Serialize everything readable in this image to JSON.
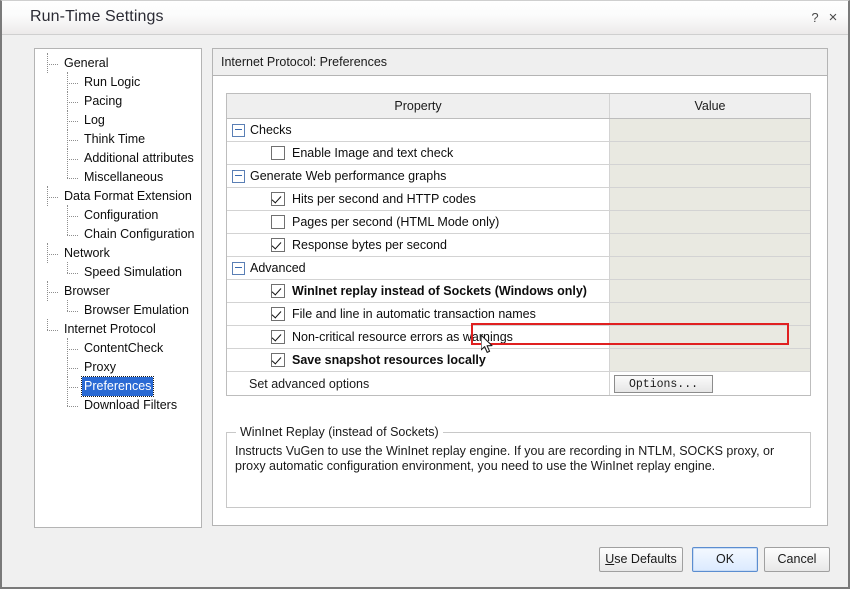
{
  "window": {
    "title": "Run-Time Settings",
    "help_icon": "question-mark-icon",
    "close_icon": "close-x-icon",
    "help_label": "?",
    "close_label": "×"
  },
  "sidebar": {
    "items": [
      {
        "label": "General",
        "level": 1,
        "selected": false,
        "last": false
      },
      {
        "label": "Run Logic",
        "level": 2,
        "selected": false,
        "last": false
      },
      {
        "label": "Pacing",
        "level": 2,
        "selected": false,
        "last": false
      },
      {
        "label": "Log",
        "level": 2,
        "selected": false,
        "last": false
      },
      {
        "label": "Think Time",
        "level": 2,
        "selected": false,
        "last": false
      },
      {
        "label": "Additional attributes",
        "level": 2,
        "selected": false,
        "last": false
      },
      {
        "label": "Miscellaneous",
        "level": 2,
        "selected": false,
        "last": true
      },
      {
        "label": "Data Format Extension",
        "level": 1,
        "selected": false,
        "last": false
      },
      {
        "label": "Configuration",
        "level": 2,
        "selected": false,
        "last": false
      },
      {
        "label": "Chain Configuration",
        "level": 2,
        "selected": false,
        "last": true
      },
      {
        "label": "Network",
        "level": 1,
        "selected": false,
        "last": false
      },
      {
        "label": "Speed Simulation",
        "level": 2,
        "selected": false,
        "last": true
      },
      {
        "label": "Browser",
        "level": 1,
        "selected": false,
        "last": false
      },
      {
        "label": "Browser Emulation",
        "level": 2,
        "selected": false,
        "last": true
      },
      {
        "label": "Internet Protocol",
        "level": 1,
        "selected": false,
        "last": true
      },
      {
        "label": "ContentCheck",
        "level": 2,
        "selected": false,
        "last": false
      },
      {
        "label": "Proxy",
        "level": 2,
        "selected": false,
        "last": false
      },
      {
        "label": "Preferences",
        "level": 2,
        "selected": true,
        "last": false
      },
      {
        "label": "Download Filters",
        "level": 2,
        "selected": false,
        "last": true
      }
    ]
  },
  "panel": {
    "header": "Internet Protocol: Preferences"
  },
  "grid": {
    "columns": {
      "property": "Property",
      "value": "Value"
    },
    "rows": [
      {
        "kind": "group",
        "label": "Checks",
        "expanded": true
      },
      {
        "kind": "checkbox",
        "label": "Enable Image and text check",
        "checked": false,
        "bold": false
      },
      {
        "kind": "group",
        "label": "Generate Web performance graphs",
        "expanded": true
      },
      {
        "kind": "checkbox",
        "label": "Hits per second and HTTP codes",
        "checked": true,
        "bold": false
      },
      {
        "kind": "checkbox",
        "label": "Pages per second (HTML Mode only)",
        "checked": false,
        "bold": false
      },
      {
        "kind": "checkbox",
        "label": "Response bytes per second",
        "checked": true,
        "bold": false
      },
      {
        "kind": "group",
        "label": "Advanced",
        "expanded": true
      },
      {
        "kind": "checkbox",
        "label": "WinInet replay instead of Sockets (Windows only)",
        "checked": true,
        "bold": true
      },
      {
        "kind": "checkbox",
        "label": "File and line in automatic transaction names",
        "checked": true,
        "bold": false
      },
      {
        "kind": "checkbox",
        "label": "Non-critical resource errors as warnings",
        "checked": true,
        "bold": false
      },
      {
        "kind": "checkbox",
        "label": "Save snapshot resources locally",
        "checked": true,
        "bold": true
      },
      {
        "kind": "plain",
        "label": "Set advanced options",
        "value_button": "Options..."
      }
    ]
  },
  "description": {
    "legend": "WinInet Replay (instead of Sockets)",
    "body": "Instructs VuGen to use the WinInet replay engine. If you are recording in NTLM, SOCKS proxy, or proxy automatic configuration environment, you need to use the WinInet replay engine."
  },
  "footer": {
    "use_defaults_mnemonic": "U",
    "use_defaults_rest": "se Defaults",
    "ok": "OK",
    "cancel": "Cancel"
  },
  "colors": {
    "selection_blue": "#2a6ad4",
    "highlight_red": "#e02020",
    "value_cell": "#e9e9e1"
  }
}
